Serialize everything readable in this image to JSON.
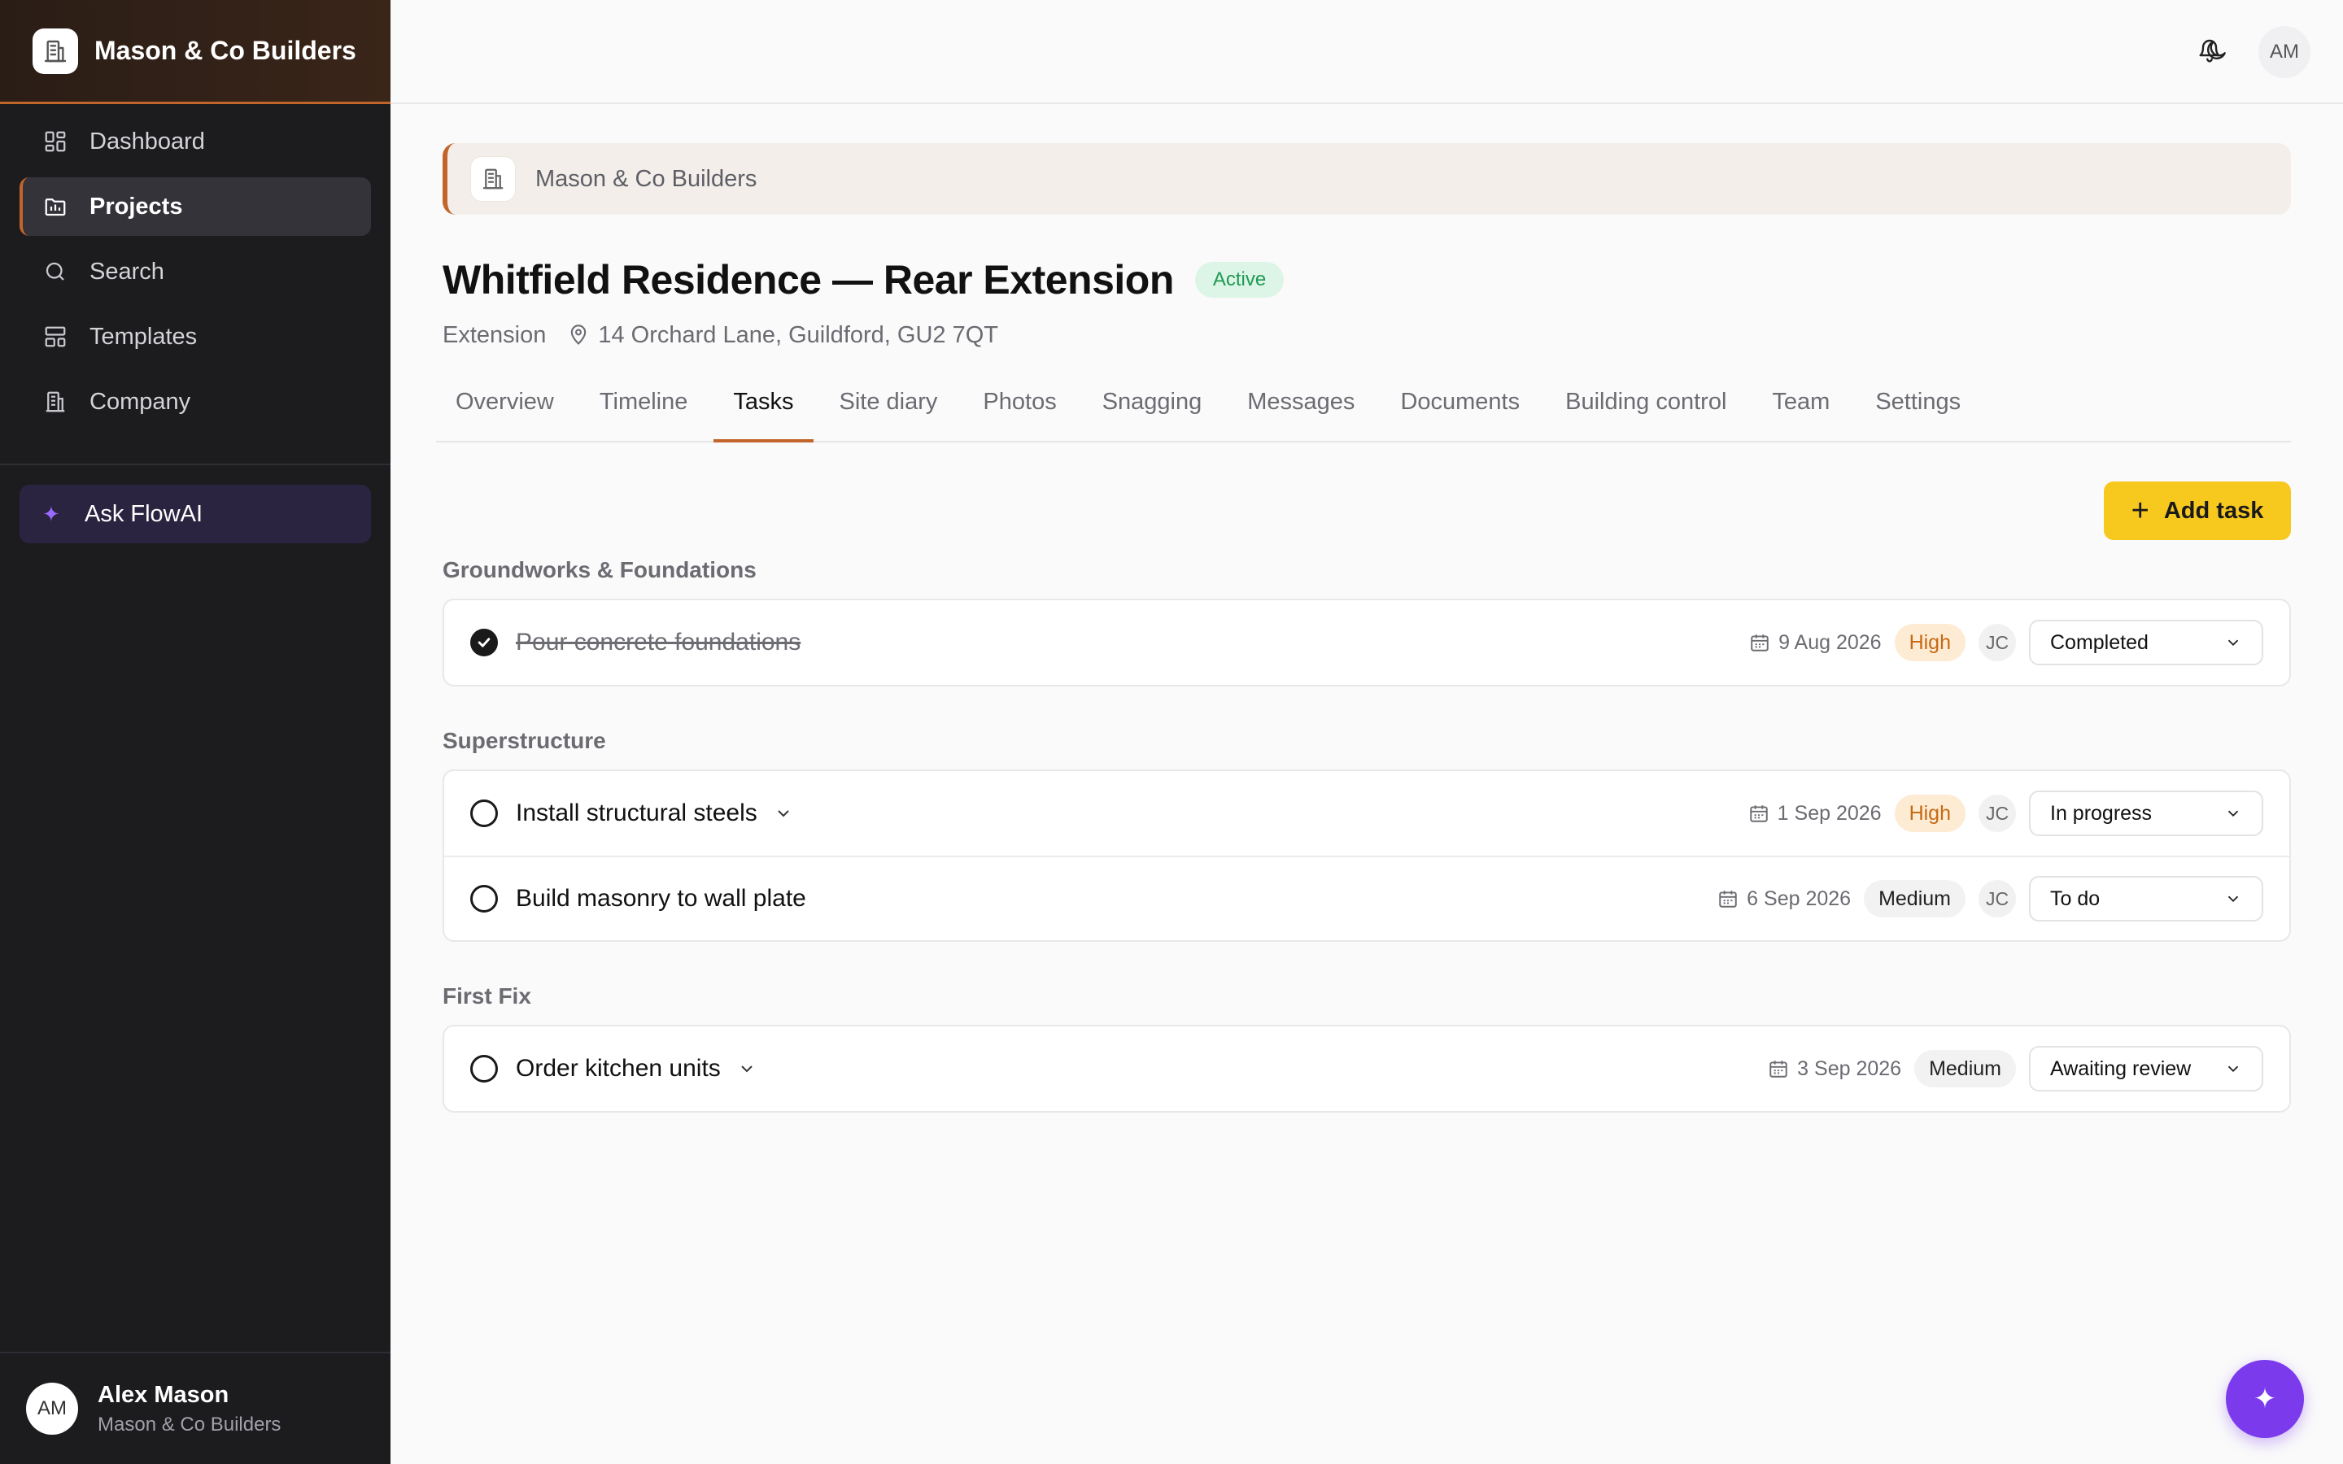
{
  "app": {
    "brand_name": "Mason & Co Builders",
    "accent_color": "#c2652a"
  },
  "sidebar": {
    "items": [
      {
        "label": "Dashboard",
        "icon": "dashboard-icon",
        "active": false
      },
      {
        "label": "Projects",
        "icon": "projects-icon",
        "active": true
      },
      {
        "label": "Search",
        "icon": "search-icon",
        "active": false
      },
      {
        "label": "Templates",
        "icon": "templates-icon",
        "active": false
      },
      {
        "label": "Company",
        "icon": "company-icon",
        "active": false
      }
    ],
    "ai_label": "Ask FlowAI",
    "user": {
      "initials": "AM",
      "name": "Alex Mason",
      "org": "Mason & Co Builders"
    }
  },
  "topbar": {
    "avatar_initials": "AM",
    "icons": [
      "moon-icon",
      "bell-icon"
    ]
  },
  "main": {
    "company_name": "Mason & Co Builders",
    "project_title": "Whitfield Residence — Rear Extension",
    "status": "Active",
    "project_type": "Extension",
    "address": "14 Orchard Lane, Guildford, GU2 7QT",
    "tabs": [
      {
        "label": "Overview",
        "active": false
      },
      {
        "label": "Timeline",
        "active": false
      },
      {
        "label": "Tasks",
        "active": true
      },
      {
        "label": "Site diary",
        "active": false
      },
      {
        "label": "Photos",
        "active": false
      },
      {
        "label": "Snagging",
        "active": false
      },
      {
        "label": "Messages",
        "active": false
      },
      {
        "label": "Documents",
        "active": false
      },
      {
        "label": "Building control",
        "active": false
      },
      {
        "label": "Team",
        "active": false
      },
      {
        "label": "Settings",
        "active": false
      }
    ],
    "add_task_label": "Add task",
    "groups": [
      {
        "title": "Groundworks & Foundations",
        "tasks": [
          {
            "name": "Pour concrete foundations",
            "done": true,
            "expandable": false,
            "date": "9 Aug 2026",
            "priority": "High",
            "assignee": "JC",
            "status": "Completed"
          }
        ]
      },
      {
        "title": "Superstructure",
        "tasks": [
          {
            "name": "Install structural steels",
            "done": false,
            "expandable": true,
            "date": "1 Sep 2026",
            "priority": "High",
            "assignee": "JC",
            "status": "In progress"
          },
          {
            "name": "Build masonry to wall plate",
            "done": false,
            "expandable": false,
            "date": "6 Sep 2026",
            "priority": "Medium",
            "assignee": "JC",
            "status": "To do"
          }
        ]
      },
      {
        "title": "First Fix",
        "tasks": [
          {
            "name": "Order kitchen units",
            "done": false,
            "expandable": true,
            "date": "3 Sep 2026",
            "priority": "Medium",
            "assignee": "",
            "status": "Awaiting review"
          }
        ]
      }
    ]
  },
  "fab_icon": "sparkle-icon"
}
